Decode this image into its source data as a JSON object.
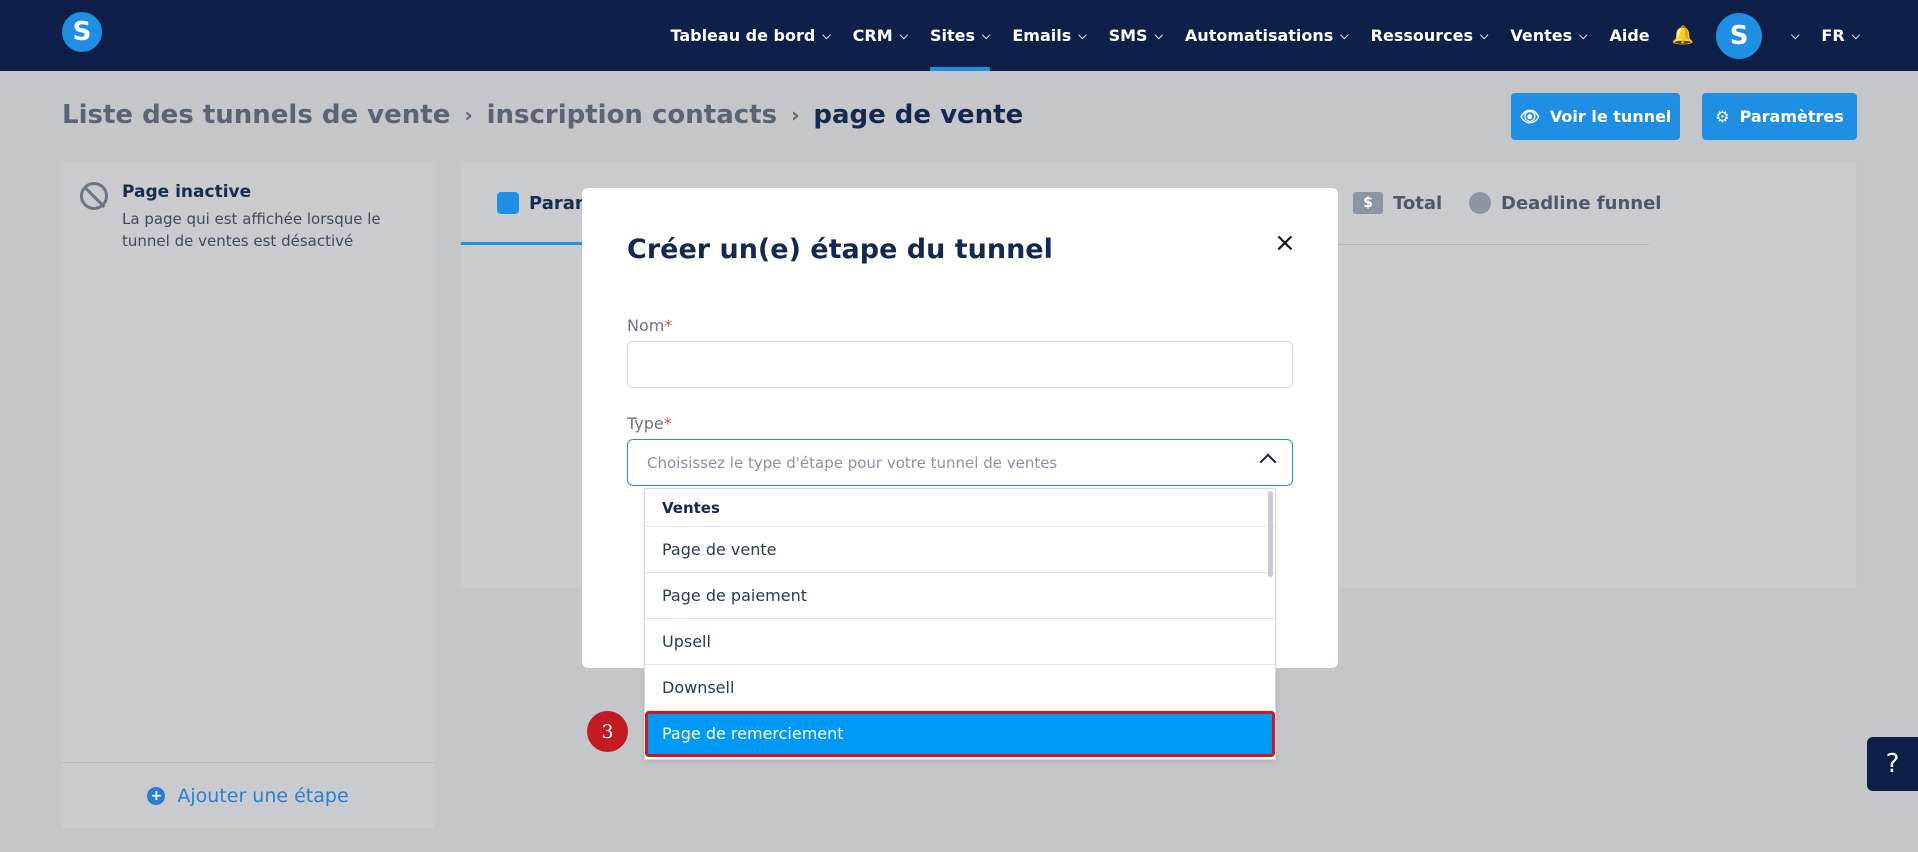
{
  "topbar": {
    "logo_letter": "S",
    "nav": [
      {
        "label": "Tableau de bord",
        "has_dropdown": true
      },
      {
        "label": "CRM",
        "has_dropdown": true
      },
      {
        "label": "Sites",
        "has_dropdown": true,
        "active": true
      },
      {
        "label": "Emails",
        "has_dropdown": true
      },
      {
        "label": "SMS",
        "has_dropdown": true
      },
      {
        "label": "Automatisations",
        "has_dropdown": true
      },
      {
        "label": "Ressources",
        "has_dropdown": true
      },
      {
        "label": "Ventes",
        "has_dropdown": true
      },
      {
        "label": "Aide",
        "has_dropdown": false
      }
    ],
    "bell_icon": "bell-icon",
    "avatar_letter": "S",
    "language": "FR"
  },
  "breadcrumb": {
    "items": [
      "Liste des tunnels de vente",
      "inscription contacts"
    ],
    "current": "page de vente"
  },
  "actions": {
    "view_label": "Voir le tunnel",
    "settings_label": "Paramètres"
  },
  "sidebar": {
    "inactive_title": "Page inactive",
    "inactive_desc": "La page qui est affichée lorsque le tunnel de ventes est désactivé",
    "add_step_label": "Ajouter une étape"
  },
  "tabs": {
    "params_label": "Param",
    "total_label": "Total",
    "total_icon_text": "$",
    "deadline_label": "Deadline funnel"
  },
  "modal": {
    "title": "Créer un(e) étape du tunnel",
    "close_label": "×",
    "name_label": "Nom",
    "type_label": "Type",
    "required_mark": "*",
    "type_placeholder": "Choisissez le type d'étape pour votre tunnel de ventes"
  },
  "dropdown": {
    "group": "Ventes",
    "options": [
      "Page de vente",
      "Page de paiement",
      "Upsell",
      "Downsell",
      "Page de remerciement"
    ],
    "selected": "Page de remerciement"
  },
  "step_marker": "3",
  "help_label": "?",
  "colors": {
    "navy": "#0e1f49",
    "accent": "#1f8fe4",
    "selected": "#0099f5",
    "highlight": "#c21b22"
  }
}
